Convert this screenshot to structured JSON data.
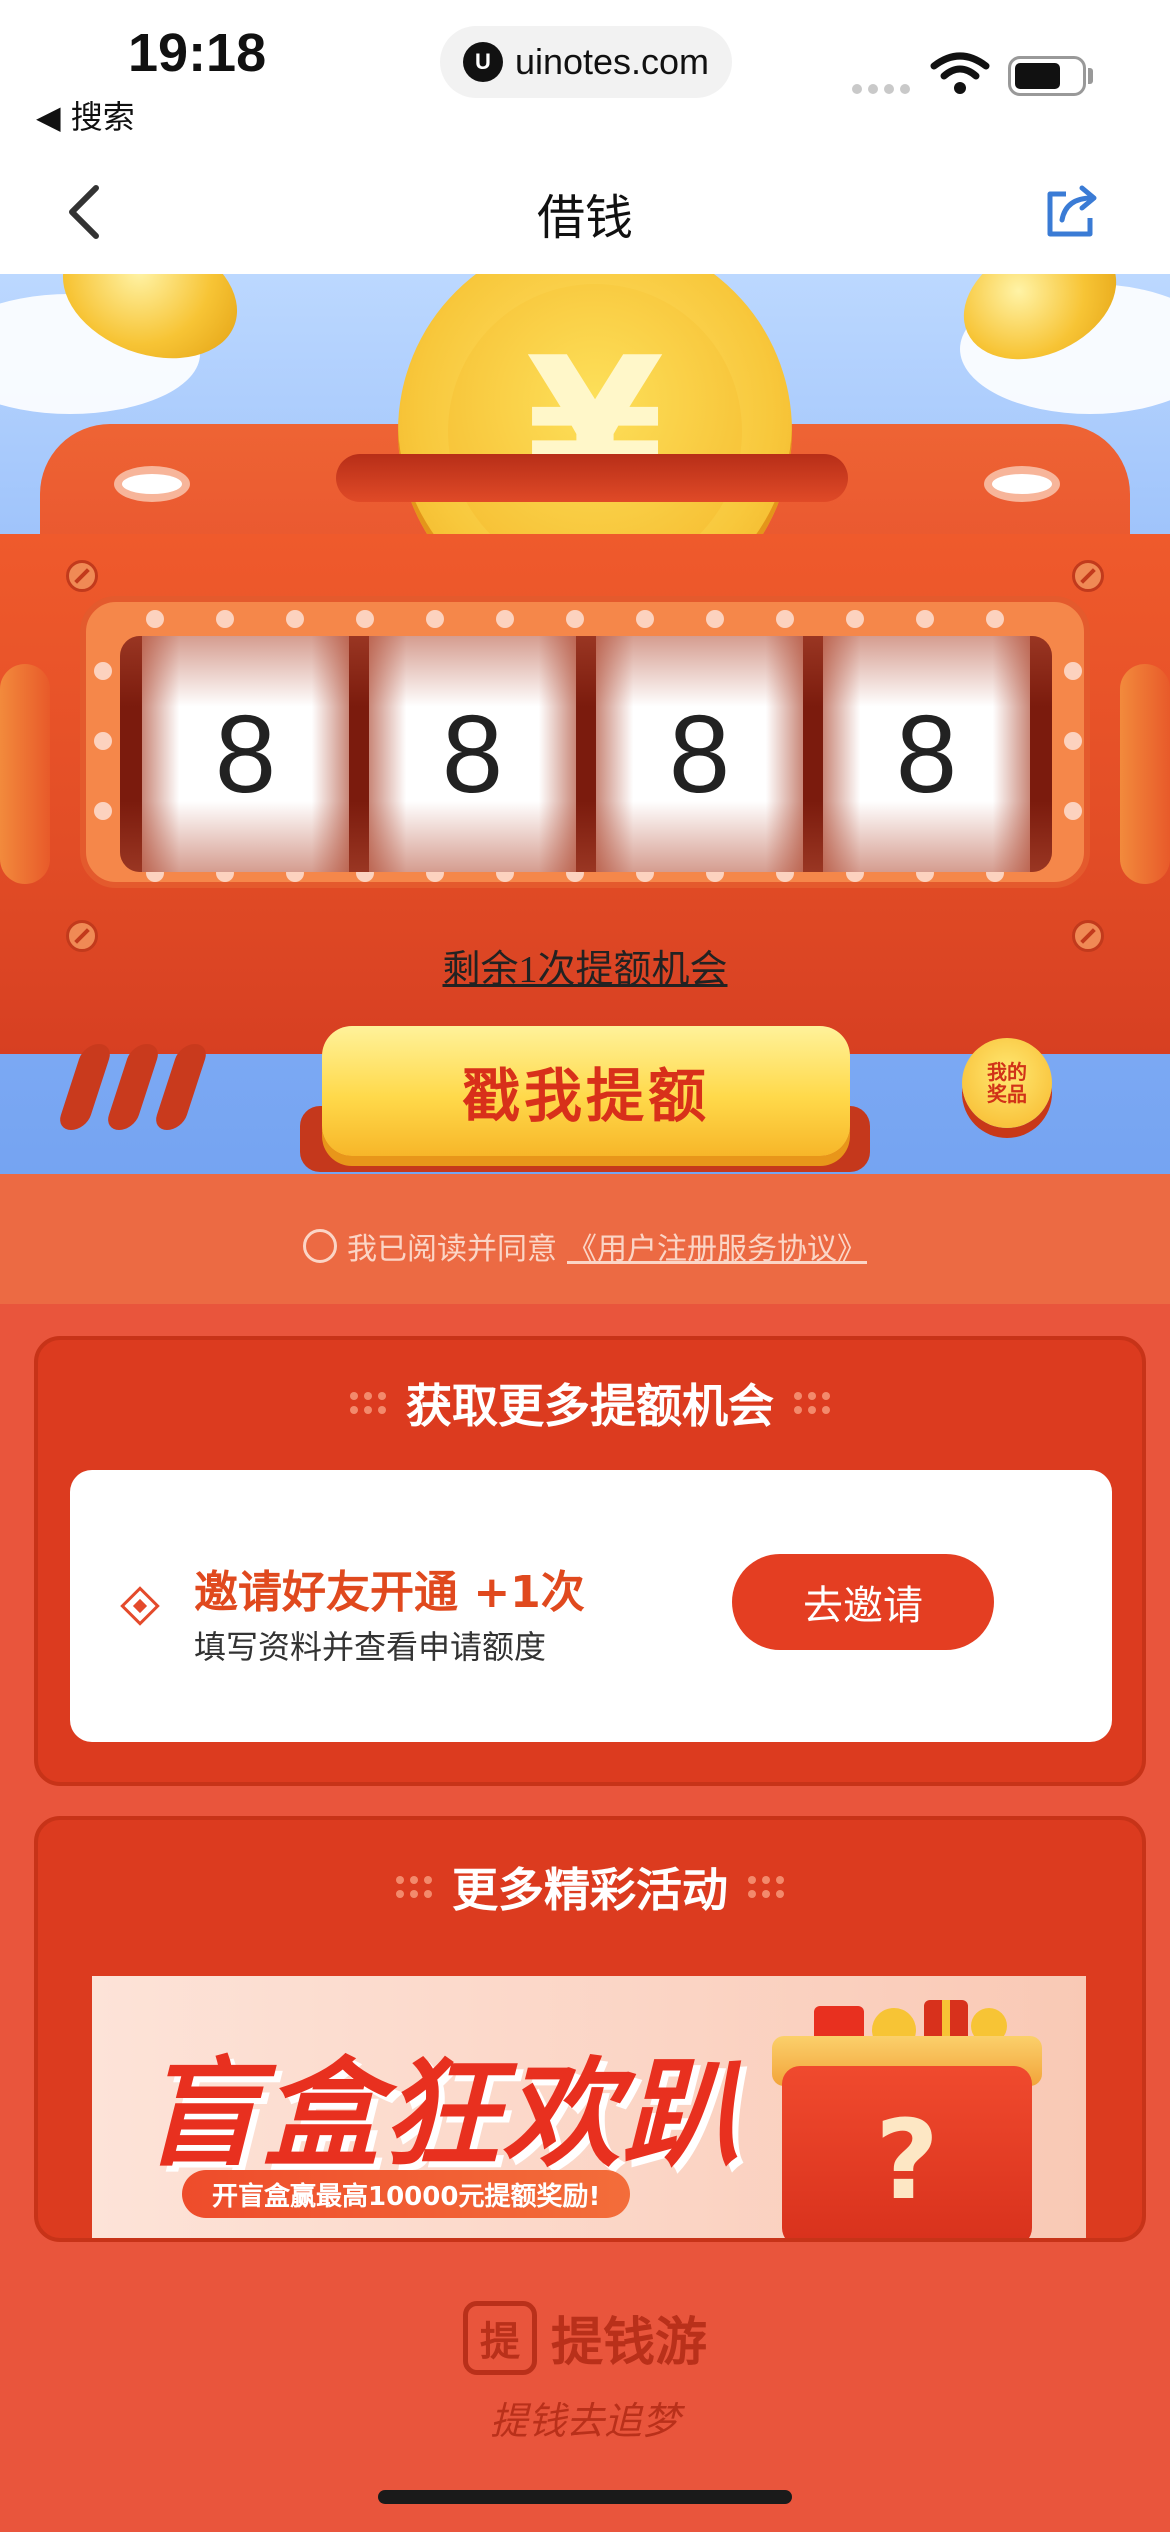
{
  "status_bar": {
    "time": "19:18",
    "back_app": "◀ 搜索",
    "url": "uinotes.com"
  },
  "nav": {
    "title": "借钱"
  },
  "machine": {
    "reels": [
      "8",
      "8",
      "8",
      "8"
    ],
    "chance_text": "剩余1次提额机会",
    "main_button": "戳我提额",
    "prize_button_line1": "我的",
    "prize_button_line2": "奖品",
    "agreement_prefix": "我已阅读并同意",
    "agreement_link": "《用户注册服务协议》"
  },
  "more_chances": {
    "title": "获取更多提额机会",
    "task": {
      "title": "邀请好友开通 +1次",
      "subtitle": "填写资料并查看申请额度",
      "button": "去邀请"
    }
  },
  "activities": {
    "title": "更多精彩活动",
    "banner": {
      "title": "盲盒狂欢趴",
      "subtitle": "开盲盒赢最高10000元提额奖励!",
      "box_mark": "?"
    }
  },
  "footer": {
    "brand_icon_text": "提",
    "brand_name": "提钱游",
    "slogan": "提钱去追梦"
  },
  "colors": {
    "primary_red": "#e43e22",
    "card_red": "#dc3b1f",
    "button_yellow": "#ffd94a",
    "task_title_orange": "#e0491e"
  },
  "icons": [
    "back-chevron-icon",
    "share-icon",
    "wifi-icon",
    "battery-icon",
    "yuan-coin-icon",
    "diamond-icon",
    "radio-circle-icon"
  ]
}
